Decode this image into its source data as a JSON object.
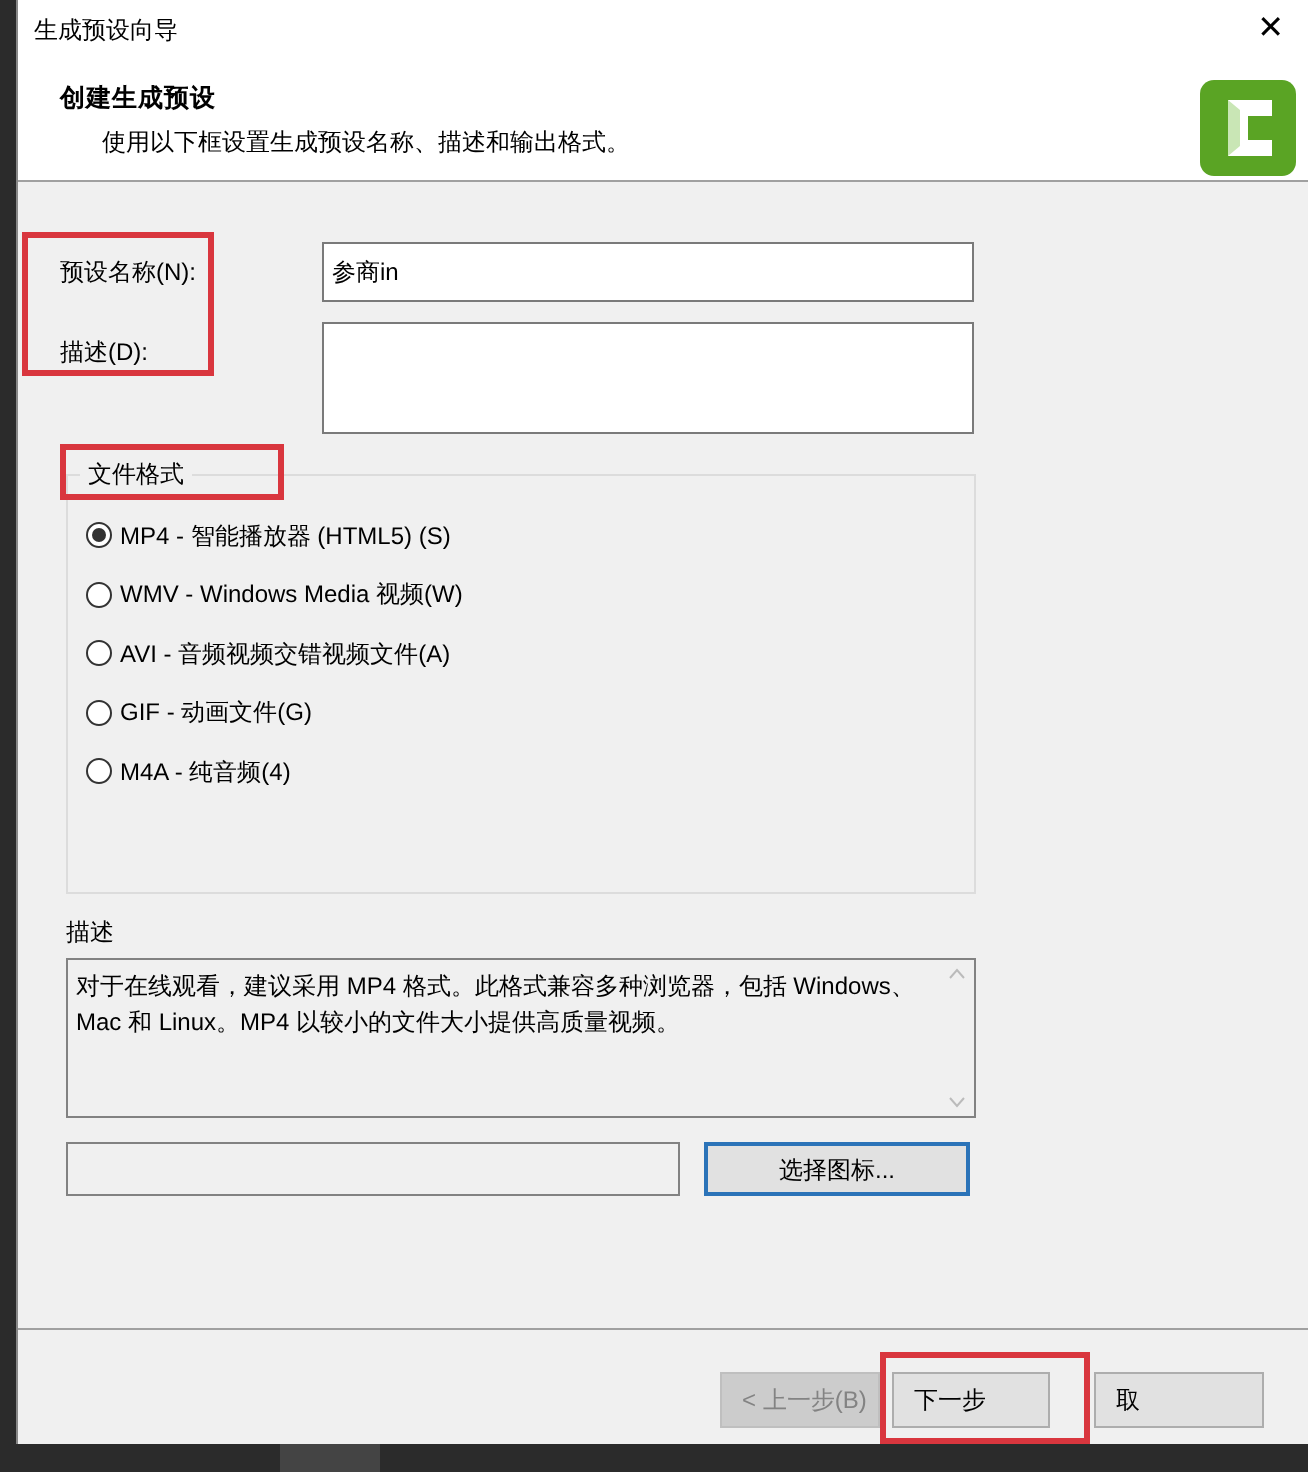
{
  "window": {
    "title": "生成预设向导",
    "close": "✕"
  },
  "header": {
    "title": "创建生成预设",
    "subtitle": "使用以下框设置生成预设名称、描述和输出格式。"
  },
  "form": {
    "highlighted": true,
    "fields": [
      {
        "label": "预设名称(N):",
        "value": "参商in",
        "kind": "line"
      },
      {
        "label": "描述(D):",
        "kind": "area"
      }
    ]
  },
  "format_group": {
    "title": "文件格式",
    "highlighted": true,
    "options": [
      {
        "label": "MP4 - 智能播放器 (HTML5) (S)",
        "selected": true
      },
      {
        "label": "WMV - Windows Media 视频(W)",
        "selected": false
      },
      {
        "label": "AVI - 音频视频交错视频文件(A)",
        "selected": false
      },
      {
        "label": "GIF - 动画文件(G)",
        "selected": false
      },
      {
        "label": "M4A - 纯音频(4)",
        "selected": false
      }
    ]
  },
  "description": {
    "label": "描述",
    "text": "对于在线观看，建议采用 MP4 格式。此格式兼容多种浏览器，包括 Windows、Mac 和 Linux。MP4 以较小的文件大小提供高质量视频。"
  },
  "icon_picker": {
    "button": "选择图标..."
  },
  "buttons": [
    {
      "label": "< 上一步(B)",
      "disabled": true,
      "highlighted": false
    },
    {
      "label": "下一步",
      "disabled": false,
      "highlighted": true
    },
    {
      "label": "取",
      "disabled": false,
      "highlighted": false
    }
  ]
}
